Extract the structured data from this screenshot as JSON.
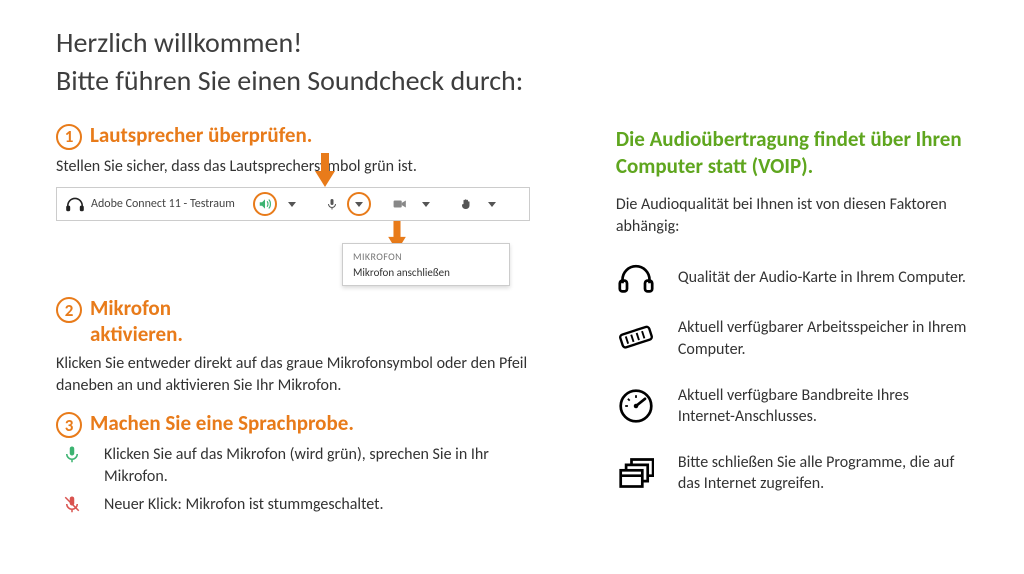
{
  "headline": {
    "line1": "Herzlich willkommen!",
    "line2": "Bitte führen Sie einen Soundcheck durch:"
  },
  "steps": {
    "s1": {
      "num": "1",
      "title": "Lautsprecher überprüfen.",
      "body": "Stellen Sie sicher, dass das Lautsprechersymbol grün ist."
    },
    "s2": {
      "num": "2",
      "title_l1": "Mikrofon",
      "title_l2": "aktivieren.",
      "body": "Klicken Sie entweder direkt auf das graue Mikrofonsymbol oder den Pfeil daneben an und aktivieren Sie Ihr Mikrofon."
    },
    "s3": {
      "num": "3",
      "title": "Machen Sie eine Sprachprobe.",
      "green": "Klicken Sie auf das Mikrofon (wird grün), sprechen Sie in Ihr Mikrofon.",
      "red": "Neuer Klick: Mikrofon ist stummgeschaltet."
    }
  },
  "toolbar": {
    "title": "Adobe Connect 11 - Testraum",
    "dropdown_header": "MIKROFON",
    "dropdown_item": "Mikrofon anschließen"
  },
  "right": {
    "heading": "Die Audioübertragung findet über Ihren Computer statt (VOIP).",
    "intro": "Die Audioqualität bei Ihnen ist von diesen Faktoren abhängig:",
    "f1": "Qualität der Audio-Karte in Ihrem Computer.",
    "f2": "Aktuell verfügbarer Arbeitsspeicher in Ihrem Computer.",
    "f3": "Aktuell verfügbare Bandbreite Ihres Internet-Anschlusses.",
    "f4": "Bitte schließen Sie alle Programme, die auf das Internet zugreifen."
  }
}
